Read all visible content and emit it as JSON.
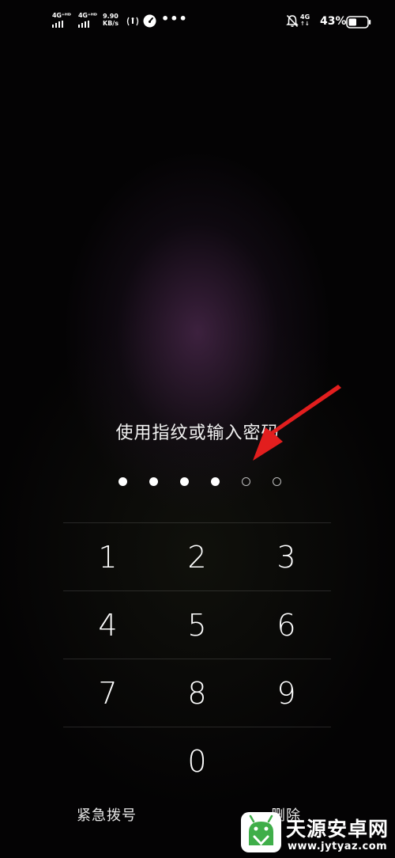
{
  "status_bar": {
    "sim1_net": "4G⁺ᴴᴰ",
    "sim2_net": "4G⁺ᴴᴰ",
    "speed_value": "9.90",
    "speed_unit": "KB/s",
    "more": "•••",
    "right_net": "4G",
    "battery": "43%",
    "battery_level": 0.43
  },
  "lock": {
    "prompt": "使用指纹或输入密码",
    "pin_length": 6,
    "pin_filled": 4,
    "keys": [
      [
        "1",
        "2",
        "3"
      ],
      [
        "4",
        "5",
        "6"
      ],
      [
        "7",
        "8",
        "9"
      ],
      [
        "",
        "0",
        ""
      ]
    ],
    "emergency_call": "紧急拨号",
    "delete": "删除"
  },
  "annotation": {
    "arrow_color": "#e21e1e"
  },
  "watermark": {
    "title": "天源安卓网",
    "url": "www.jytyaz.com",
    "logo_color": "#3fae49"
  }
}
